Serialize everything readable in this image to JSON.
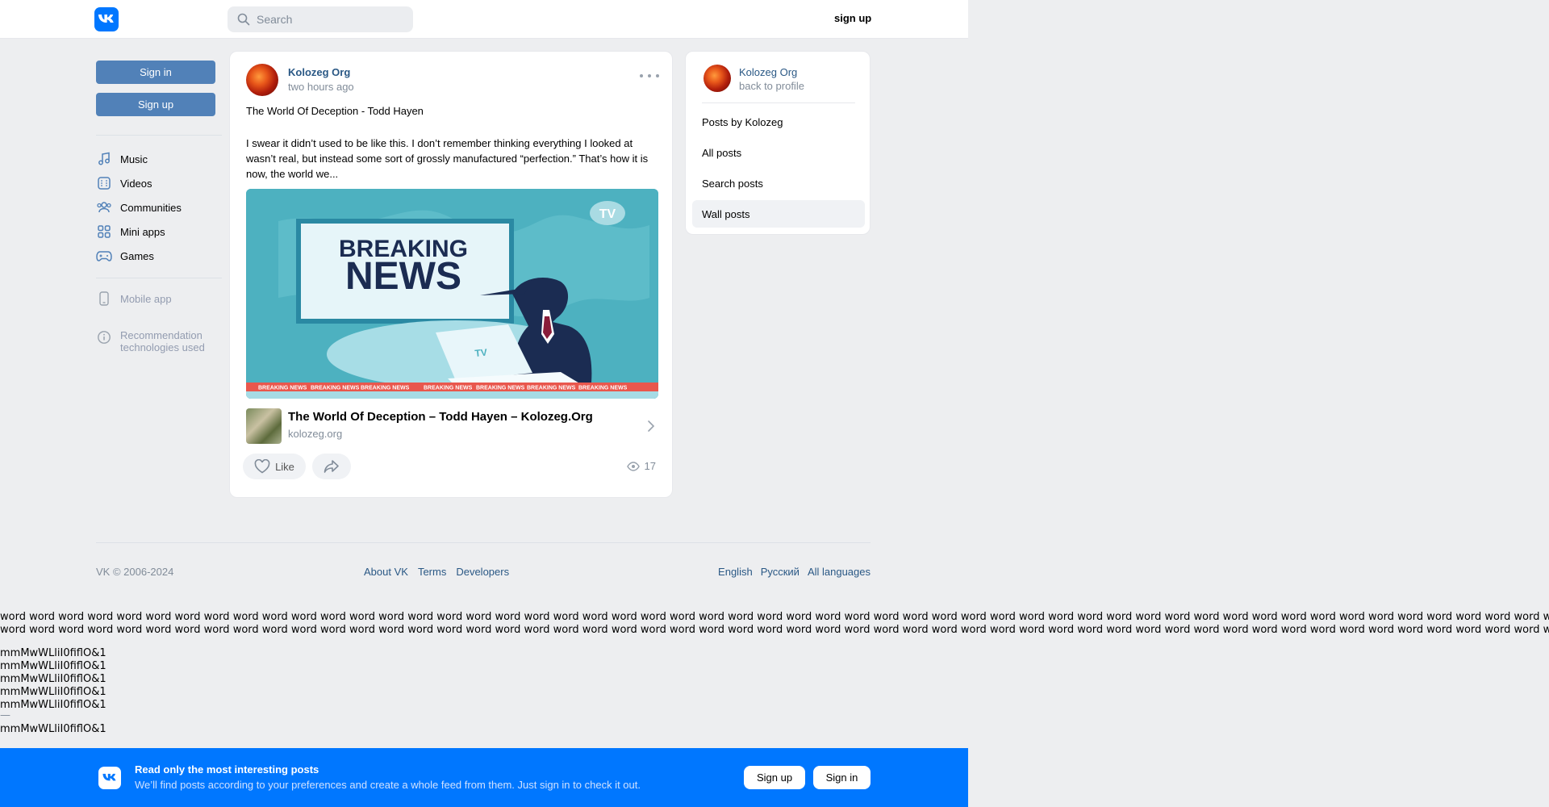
{
  "header": {
    "search_placeholder": "Search",
    "signup_label": "sign up"
  },
  "sidebar": {
    "signin_label": "Sign in",
    "signup_label": "Sign up",
    "nav": [
      {
        "label": "Music",
        "icon": "music-icon"
      },
      {
        "label": "Videos",
        "icon": "video-icon"
      },
      {
        "label": "Communities",
        "icon": "communities-icon"
      },
      {
        "label": "Mini apps",
        "icon": "mini-apps-icon"
      },
      {
        "label": "Games",
        "icon": "gamepad-icon"
      }
    ],
    "mobile_app_label": "Mobile app",
    "recommendation_label": "Recommendation technologies used"
  },
  "post": {
    "author": "Kolozeg Org",
    "time": "two hours ago",
    "title": "The World Of Deception - Todd Hayen",
    "body": "I swear it didn’t used to be like this. I don’t remember thinking everything I looked at wasn’t real, but instead some sort of grossly manufactured “perfection.” That’s how it is now, the world we...",
    "image": {
      "headline_top": "BREAKING",
      "headline_bottom": "NEWS",
      "tv_badge": "TV",
      "laptop_label": "TV",
      "ticker_text": "BREAKING NEWS"
    },
    "link": {
      "title": "The World Of Deception – Todd Hayen – Kolozeg.Org",
      "domain": "kolozeg.org"
    },
    "like_label": "Like",
    "views": "17"
  },
  "right_menu": {
    "name": "Kolozeg Org",
    "back_label": "back to profile",
    "items": [
      {
        "label": "Posts by Kolozeg",
        "active": false
      },
      {
        "label": "All posts",
        "active": false
      },
      {
        "label": "Search posts",
        "active": false
      },
      {
        "label": "Wall posts",
        "active": true
      }
    ]
  },
  "footer": {
    "copyright": "VK © 2006-2024",
    "links": [
      "About VK",
      "Terms",
      "Developers"
    ],
    "languages": [
      "English",
      "Русский",
      "All languages"
    ]
  },
  "filler": {
    "word_line": "word word word word word word word word word word word word word word word word word word word word word word word word word word word word word word word word word word word word word word word word word word word word word word word word word word word word word word word word word word word word word word word word word word word word word word",
    "glyph_line": "mmMwWLliI0fiflO&1",
    "dash": "—"
  },
  "banner": {
    "title": "Read only the most interesting posts",
    "subtitle": "We’ll find posts according to your preferences and create a whole feed from them. Just sign in to check it out.",
    "signup_label": "Sign up",
    "signin_label": "Sign in"
  },
  "colors": {
    "vk_blue": "#0077ff",
    "button_blue": "#5181b8",
    "link_blue": "#2a5885",
    "background": "#edeef0"
  }
}
